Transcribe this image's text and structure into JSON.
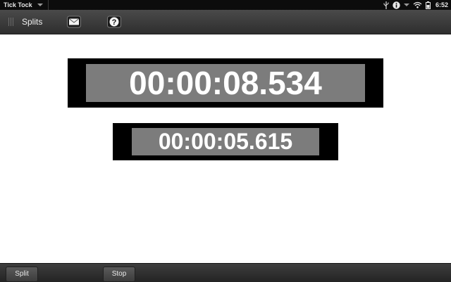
{
  "status_bar": {
    "app_name": "Tick Tock",
    "time": "6:52",
    "icons": [
      "app-menu-arrow-icon",
      "usb-icon",
      "info-icon",
      "status-menu-arrow-icon",
      "wifi-icon",
      "battery-icon"
    ]
  },
  "toolbar": {
    "title": "Splits",
    "icons": [
      "grip-icon",
      "email-icon",
      "help-icon"
    ]
  },
  "timers": {
    "main": "00:00:08.534",
    "split": "00:00:05.615"
  },
  "commands": {
    "split_label": "Split",
    "stop_label": "Stop"
  },
  "colors": {
    "timer_face": "#7c7c7c",
    "timer_frame": "#000000",
    "toolbar": "#3a3a3a"
  }
}
